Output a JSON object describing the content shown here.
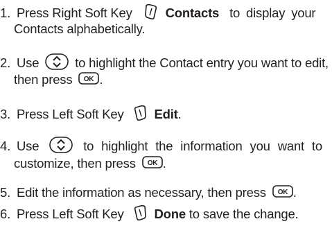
{
  "steps": [
    {
      "number": "1.",
      "pre": "Press Right Soft Key",
      "key_label": "Contacts",
      "post": "to display your",
      "line2": "Contacts alphabetically."
    },
    {
      "number": "2.",
      "pre": "Use",
      "post": "to highlight the Contact entry you want to edit,",
      "line2_pre": "then press",
      "line2_post": "."
    },
    {
      "number": "3.",
      "pre": "Press Left Soft Key",
      "key_label": "Edit",
      "post": "."
    },
    {
      "number": "4.",
      "pre": "Use",
      "post": "to highlight the information you want to",
      "line2_pre": "customize, then press",
      "line2_post": "."
    },
    {
      "number": "5.",
      "pre": "Edit the information as necessary, then press",
      "post": "."
    },
    {
      "number": "6.",
      "pre": "Press Left Soft Key",
      "key_label": "Done",
      "post": "to save the change."
    }
  ],
  "ok_key_label": "OK",
  "icons": {
    "right_soft_key": "right-soft-key-icon",
    "left_soft_key": "left-soft-key-icon",
    "nav_key": "navigation-key-icon",
    "ok_key": "ok-key-icon"
  }
}
